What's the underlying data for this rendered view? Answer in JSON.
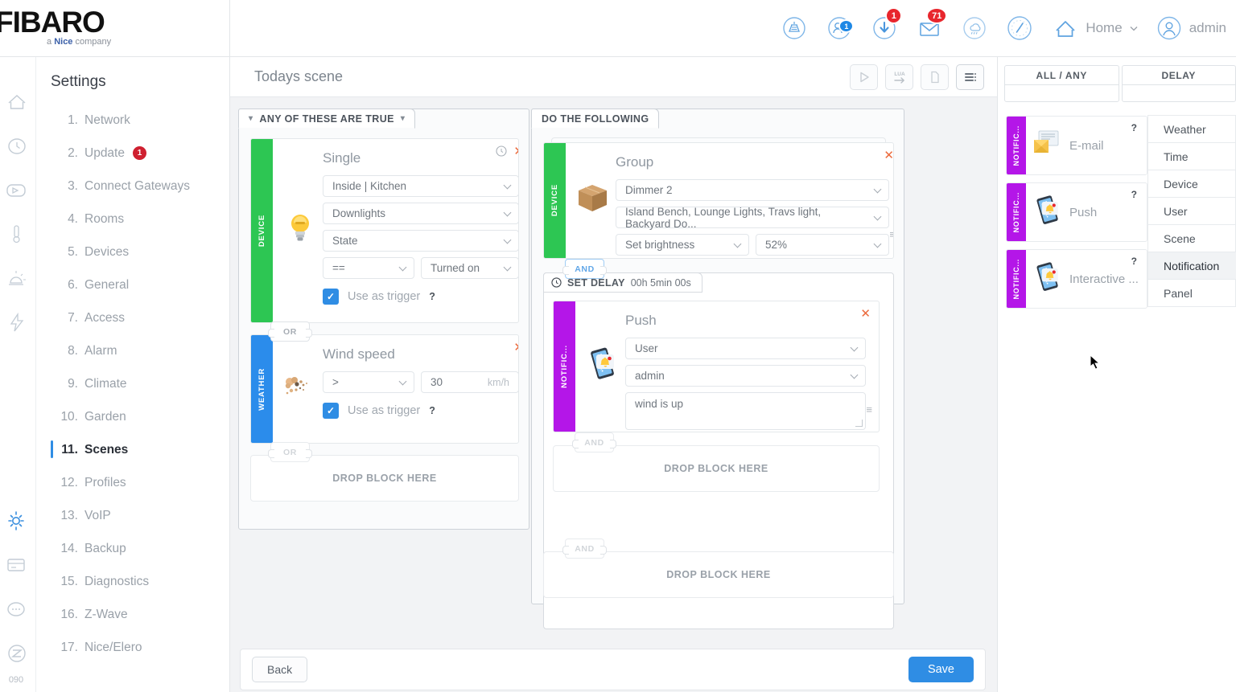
{
  "brand": {
    "name": "FIBARO",
    "tagline_pre": "a ",
    "tagline_bold": "Nice",
    "tagline_post": " company"
  },
  "topbar": {
    "icons": [
      {
        "name": "alarm-siren-icon",
        "badge": null
      },
      {
        "name": "users-icon",
        "badge": "1",
        "badge_type": "blue"
      },
      {
        "name": "download-icon",
        "badge": "1",
        "badge_type": "red"
      },
      {
        "name": "mail-icon",
        "badge": "71",
        "badge_type": "red"
      },
      {
        "name": "climate-icon",
        "badge": null
      },
      {
        "name": "gauge-icon",
        "badge": null
      }
    ],
    "home_label": "Home",
    "user_label": "admin"
  },
  "rail": {
    "icons": [
      "home-icon",
      "clock-icon",
      "remote-icon",
      "thermometer-icon",
      "siren-icon",
      "energy-icon",
      "gear-icon",
      "panel-icon",
      "voip-icon",
      "zwave-icon"
    ],
    "version": "090"
  },
  "settings": {
    "title": "Settings",
    "items": [
      {
        "num": "1.",
        "label": "Network",
        "badge": null,
        "active": false
      },
      {
        "num": "2.",
        "label": "Update",
        "badge": "1",
        "active": false
      },
      {
        "num": "3.",
        "label": "Connect Gateways",
        "badge": null,
        "active": false
      },
      {
        "num": "4.",
        "label": "Rooms",
        "badge": null,
        "active": false
      },
      {
        "num": "5.",
        "label": "Devices",
        "badge": null,
        "active": false
      },
      {
        "num": "6.",
        "label": "General",
        "badge": null,
        "active": false
      },
      {
        "num": "7.",
        "label": "Access",
        "badge": null,
        "active": false
      },
      {
        "num": "8.",
        "label": "Alarm",
        "badge": null,
        "active": false
      },
      {
        "num": "9.",
        "label": "Climate",
        "badge": null,
        "active": false
      },
      {
        "num": "10.",
        "label": "Garden",
        "badge": null,
        "active": false
      },
      {
        "num": "11.",
        "label": "Scenes",
        "badge": null,
        "active": true
      },
      {
        "num": "12.",
        "label": "Profiles",
        "badge": null,
        "active": false
      },
      {
        "num": "13.",
        "label": "VoIP",
        "badge": null,
        "active": false
      },
      {
        "num": "14.",
        "label": "Backup",
        "badge": null,
        "active": false
      },
      {
        "num": "15.",
        "label": "Diagnostics",
        "badge": null,
        "active": false
      },
      {
        "num": "16.",
        "label": "Z-Wave",
        "badge": null,
        "active": false
      },
      {
        "num": "17.",
        "label": "Nice/Elero",
        "badge": null,
        "active": false
      }
    ]
  },
  "scene_header": {
    "title": "Todays scene",
    "buttons": [
      {
        "name": "run-scene-button",
        "glyph": "play-icon"
      },
      {
        "name": "lua-convert-button",
        "glyph": "lua-arrow-icon"
      },
      {
        "name": "copy-scene-button",
        "glyph": "copy-icon"
      },
      {
        "name": "scene-menu-button",
        "glyph": "list-icon"
      }
    ]
  },
  "conditions": {
    "tab_label": "ANY OF THESE ARE TRUE",
    "blocks": [
      {
        "kind": "device",
        "strip_label": "DEVICE",
        "strip_color": "#2dc653",
        "icon": "lightbulb-icon",
        "title": "Single",
        "fields": [
          {
            "name": "room-select",
            "value": "Inside | Kitchen"
          },
          {
            "name": "device-select",
            "value": "Downlights"
          },
          {
            "name": "property-select",
            "value": "State"
          }
        ],
        "operator": "==",
        "operand": "Turned on",
        "trigger_label": "Use as trigger",
        "trigger_checked": true,
        "help": "?"
      },
      {
        "kind": "weather",
        "strip_label": "WEATHER",
        "strip_color": "#2b8ceb",
        "icon": "wind-icon",
        "title": "Wind speed",
        "operator": ">",
        "value": "30",
        "unit": "km/h",
        "trigger_label": "Use as trigger",
        "trigger_checked": true,
        "help": "?"
      }
    ],
    "connector_1": "OR",
    "connector_2": "OR",
    "drop_label": "DROP BLOCK HERE"
  },
  "actions": {
    "tab_label": "DO THE FOLLOWING",
    "group_block": {
      "strip_label": "DEVICE",
      "strip_color": "#2dc653",
      "icon": "box-icon",
      "title": "Group",
      "fields": [
        {
          "name": "group-type-select",
          "value": "Dimmer 2"
        },
        {
          "name": "group-devices-select",
          "value": "Island Bench, Lounge Lights, Travs light, Backyard Do..."
        }
      ],
      "action_select": "Set brightness",
      "action_value": "52%"
    },
    "connector_and_1": "AND",
    "delay": {
      "label": "SET DELAY",
      "value": "00h 5min 00s"
    },
    "push_block": {
      "strip_label": "NOTIFIC...",
      "strip_color": "#b416e8",
      "icon": "phone-bell-icon",
      "title": "Push",
      "target_type": "User",
      "target_user": "admin",
      "message": "wind is up"
    },
    "connector_and_2": "AND",
    "inner_drop_label": "DROP BLOCK HERE",
    "connector_and_3": "AND",
    "outer_drop_label": "DROP BLOCK HERE"
  },
  "footer": {
    "back_label": "Back",
    "save_label": "Save"
  },
  "right_panel": {
    "tabs": [
      {
        "name": "all-any-tab",
        "label": "ALL / ANY"
      },
      {
        "name": "delay-tab",
        "label": "DELAY"
      }
    ],
    "palette": [
      {
        "name": "palette-email",
        "strip_label": "NOTIFIC...",
        "icon": "email-icon",
        "label": "E-mail",
        "help": "?"
      },
      {
        "name": "palette-push",
        "strip_label": "NOTIFIC...",
        "icon": "phone-bell-icon",
        "label": "Push",
        "help": "?"
      },
      {
        "name": "palette-interactive",
        "strip_label": "NOTIFIC...",
        "icon": "phone-bell-icon",
        "label": "Interactive ...",
        "help": "?"
      }
    ],
    "categories": [
      {
        "label": "Weather",
        "active": false
      },
      {
        "label": "Time",
        "active": false
      },
      {
        "label": "Device",
        "active": false
      },
      {
        "label": "User",
        "active": false
      },
      {
        "label": "Scene",
        "active": false
      },
      {
        "label": "Notification",
        "active": true
      },
      {
        "label": "Panel",
        "active": false
      }
    ]
  },
  "colors": {
    "accent": "#2f8de4",
    "device_green": "#2dc653",
    "weather_blue": "#2b8ceb",
    "notification_purple": "#b416e8",
    "danger_red": "#e8262d",
    "close_orange": "#eb6a3c"
  }
}
